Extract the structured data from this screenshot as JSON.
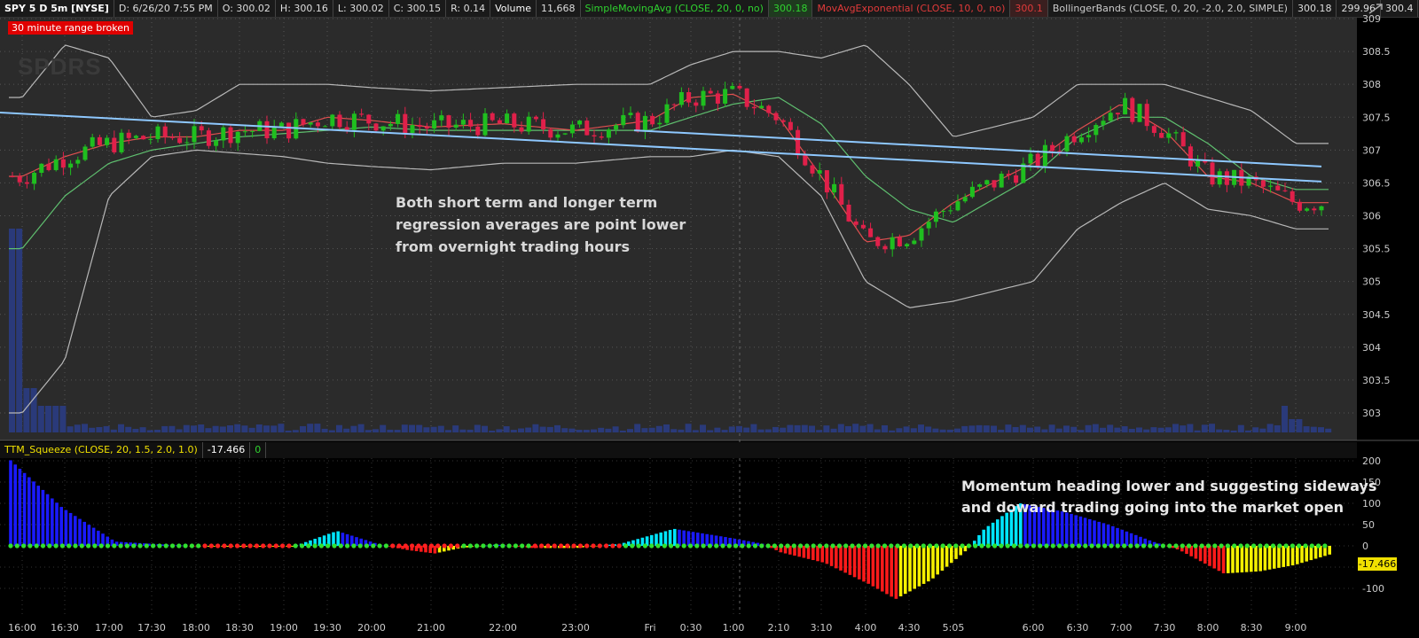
{
  "header": {
    "symbol": "SPY 5 D 5m [NYSE]",
    "date": "D: 6/26/20 7:55 PM",
    "open": "O: 300.02",
    "high": "H: 300.16",
    "low": "L: 300.02",
    "close": "C: 300.15",
    "range": "R: 0.14",
    "volume_label": "Volume",
    "volume_value": "11,668",
    "sma_label": "SimpleMovingAvg (CLOSE, 20, 0, no)",
    "sma_value": "300.18",
    "ema_label": "MovAvgExponential (CLOSE, 10, 0, no)",
    "ema_value": "300.1",
    "bb_label": "BollingerBands (CLOSE, 0, 20, -2.0, 2.0, SIMPLE)",
    "bb_upper": "300.18",
    "bb_lower": "299.96",
    "bb_mid": "300.4"
  },
  "alert_label": "30 minute range broken",
  "watermark": "SPDRS",
  "indicator_header": {
    "label": "TTM_Squeeze (CLOSE, 20, 1.5, 2.0, 1.0)",
    "value": "-17.466",
    "squeeze": "0"
  },
  "colors": {
    "bg": "#2b2b2b",
    "lower_bg": "#000000",
    "sma": "#5fbf6f",
    "ema": "#e05050",
    "bollinger": "#b8b8b8",
    "regression": "#8ec8ff",
    "candle_up": "#1fbf1f",
    "candle_down": "#e0204a",
    "volume": "#2a3a7a"
  },
  "chart_data": [
    {
      "type": "candlestick",
      "title": "",
      "ylim": [
        302.7,
        309
      ],
      "yticks": [
        303,
        303.5,
        304,
        304.5,
        305,
        305.5,
        306,
        306.5,
        307,
        307.5,
        308,
        308.5,
        309
      ],
      "xticks": [
        "16:00",
        "16:30",
        "17:00",
        "17:30",
        "18:00",
        "18:30",
        "19:00",
        "19:30",
        "20:00",
        "21:00",
        "22:00",
        "23:00",
        "Fri",
        "0:30",
        "1:00",
        "2:10",
        "3:10",
        "4:00",
        "4:30",
        "5:05",
        "6:00",
        "6:30",
        "7:00",
        "7:30",
        "8:00",
        "8:30",
        "9:00"
      ],
      "sma_20_approx": [
        305.5,
        306.3,
        306.8,
        307.0,
        307.1,
        307.2,
        307.25,
        307.3,
        307.35,
        307.3,
        307.3,
        307.3,
        307.3,
        307.5,
        307.7,
        307.8,
        307.4,
        306.6,
        306.1,
        305.9,
        306.6,
        307.2,
        307.5,
        307.5,
        307.1,
        306.6,
        306.4
      ],
      "ema_10_approx": [
        306.6,
        306.9,
        307.1,
        307.2,
        307.2,
        307.3,
        307.3,
        307.5,
        307.45,
        307.35,
        307.4,
        307.3,
        307.45,
        307.8,
        307.85,
        307.5,
        306.6,
        305.6,
        305.7,
        306.2,
        306.8,
        307.3,
        307.7,
        307.3,
        306.6,
        306.5,
        306.2
      ],
      "bb_upper_approx": [
        307.8,
        308.6,
        308.4,
        307.5,
        307.6,
        308.0,
        308.0,
        308.0,
        307.95,
        307.9,
        307.95,
        308.0,
        308.0,
        308.3,
        308.5,
        308.5,
        308.4,
        308.6,
        308.0,
        307.2,
        307.5,
        308.0,
        308.0,
        308.0,
        307.8,
        307.6,
        307.1
      ],
      "bb_lower_approx": [
        303.0,
        303.8,
        306.3,
        306.9,
        307.0,
        306.95,
        306.9,
        306.8,
        306.75,
        306.7,
        306.8,
        306.8,
        306.9,
        306.9,
        307.0,
        306.9,
        306.3,
        305.0,
        304.6,
        304.7,
        305.0,
        305.8,
        306.2,
        306.5,
        306.1,
        306.0,
        305.8
      ],
      "regression_lines": [
        {
          "from": [
            0,
            307.57
          ],
          "to": [
            1490,
            306.52
          ]
        },
        {
          "from": [
            715,
            307.3
          ],
          "to": [
            1490,
            306.75
          ]
        }
      ],
      "annotation": "Both short term and longer term regression averages are point lower from overnight trading hours"
    },
    {
      "type": "bar",
      "title": "TTM_Squeeze (CLOSE, 20, 1.5, 2.0, 1.0)",
      "ylim": [
        -125,
        210
      ],
      "yticks": [
        200,
        150,
        100,
        50,
        0,
        -50,
        -100
      ],
      "current_value": -17.466,
      "annotation": "Momentum heading lower and suggesting sideways and doward trading going into the market open"
    }
  ],
  "annotations": {
    "upper": [
      "Both short term and longer term",
      "regression averages are point lower",
      "from overnight trading hours"
    ],
    "lower": [
      "Momentum heading lower and suggesting sideways",
      "and doward trading going into the market open"
    ]
  }
}
